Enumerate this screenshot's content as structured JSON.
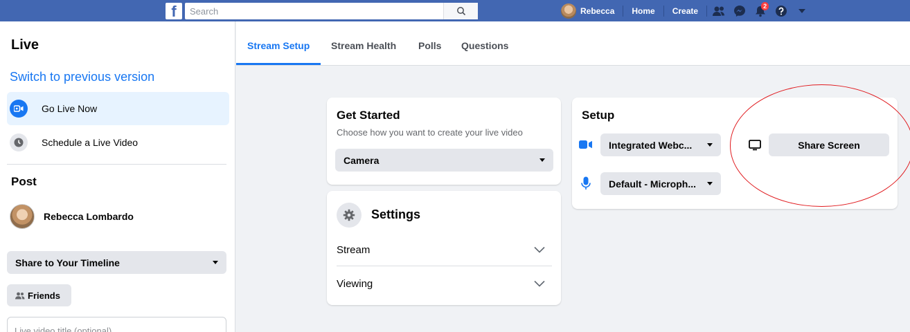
{
  "topbar": {
    "logo": "f",
    "search_placeholder": "Search",
    "user_name": "Rebecca",
    "home_label": "Home",
    "create_label": "Create",
    "notification_count": "2"
  },
  "sidebar": {
    "title": "Live",
    "switch_label": "Switch to previous version",
    "items": [
      {
        "label": "Go Live Now",
        "icon": "video-camera-icon",
        "active": true
      },
      {
        "label": "Schedule a Live Video",
        "icon": "clock-icon",
        "active": false
      }
    ],
    "post_heading": "Post",
    "user_name": "Rebecca Lombardo",
    "share_select_value": "Share to Your Timeline",
    "audience_label": "Friends",
    "title_placeholder": "Live video title (optional)"
  },
  "tabs": [
    {
      "label": "Stream Setup",
      "active": true
    },
    {
      "label": "Stream Health",
      "active": false
    },
    {
      "label": "Polls",
      "active": false
    },
    {
      "label": "Questions",
      "active": false
    }
  ],
  "get_started": {
    "title": "Get Started",
    "subtitle": "Choose how you want to create your live video",
    "select_value": "Camera"
  },
  "settings": {
    "title": "Settings",
    "rows": [
      {
        "label": "Stream"
      },
      {
        "label": "Viewing"
      }
    ]
  },
  "setup": {
    "title": "Setup",
    "camera_value": "Integrated Webc...",
    "microphone_value": "Default - Microph...",
    "share_screen_label": "Share Screen"
  },
  "colors": {
    "topbar": "#4267b2",
    "accent": "#1877f2",
    "annotation": "#e0191d"
  }
}
